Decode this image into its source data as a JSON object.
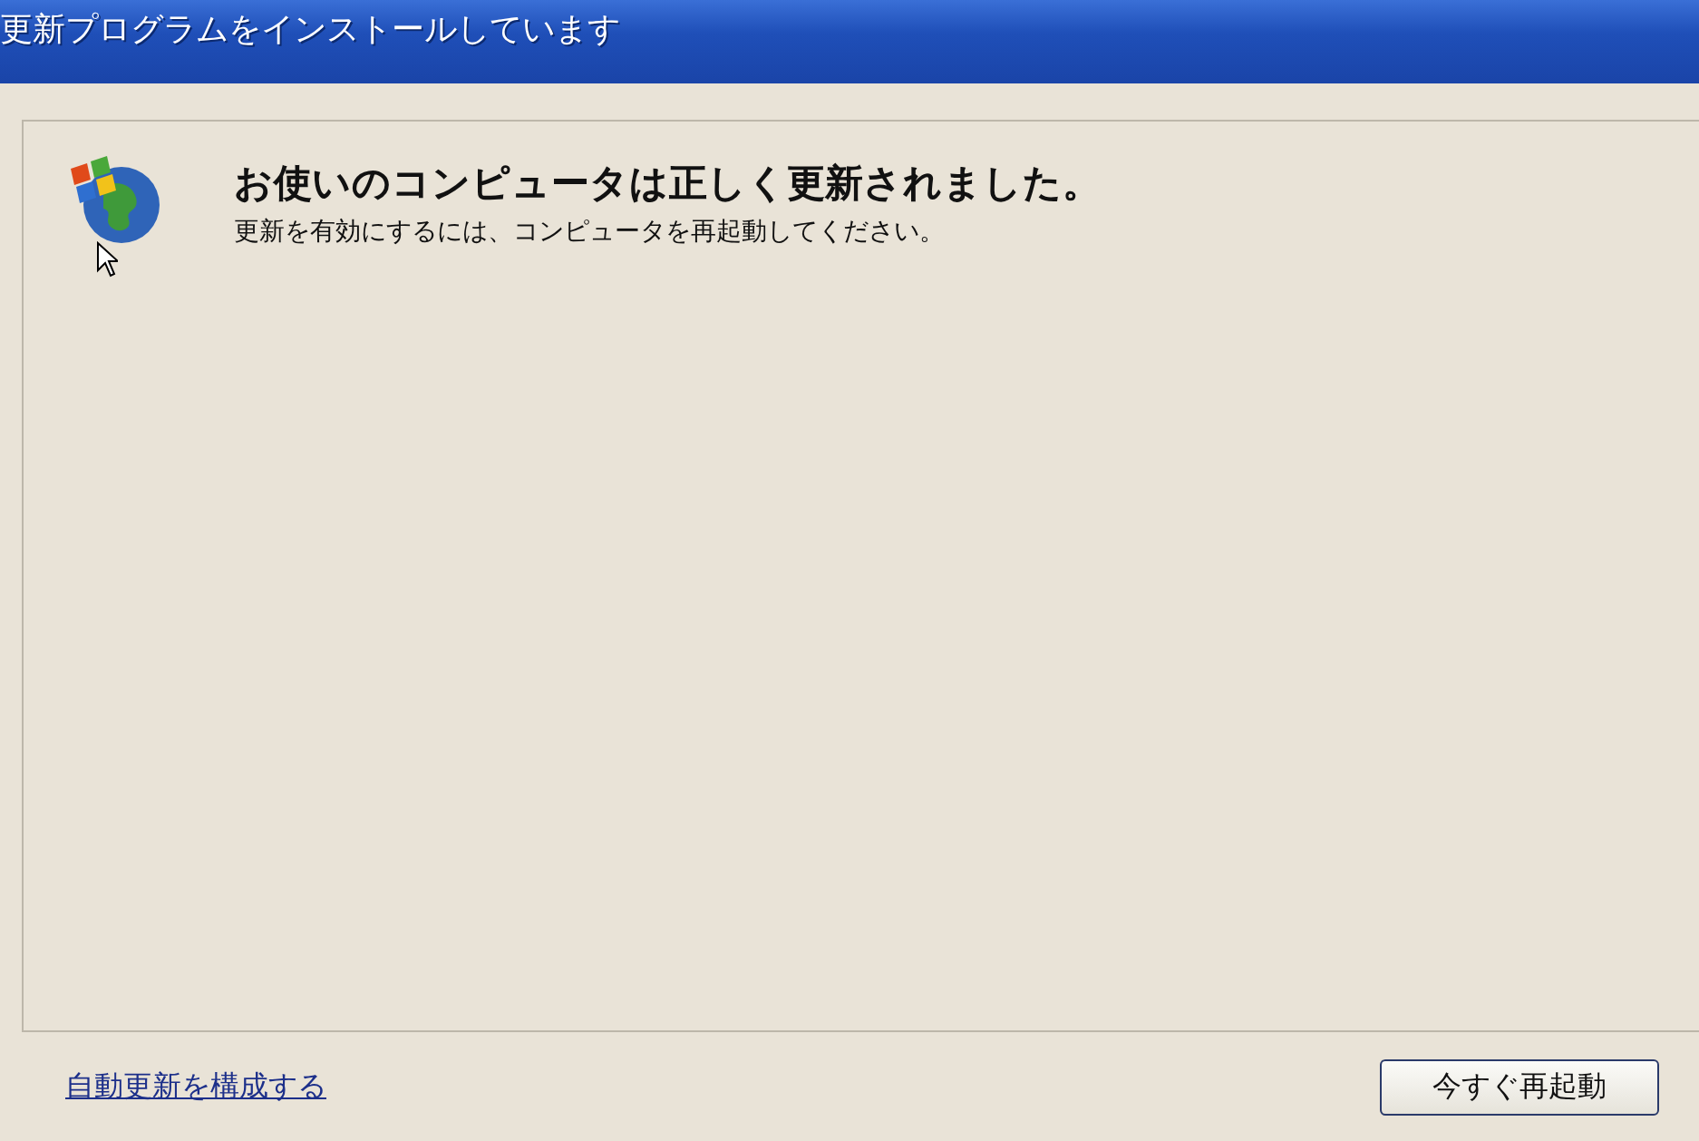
{
  "window": {
    "title": "更新プログラムをインストールしています"
  },
  "message": {
    "heading": "お使いのコンピュータは正しく更新されました。",
    "detail": "更新を有効にするには、コンピュータを再起動してください。"
  },
  "footer": {
    "link": "自動更新を構成する",
    "button": "今すぐ再起動"
  }
}
